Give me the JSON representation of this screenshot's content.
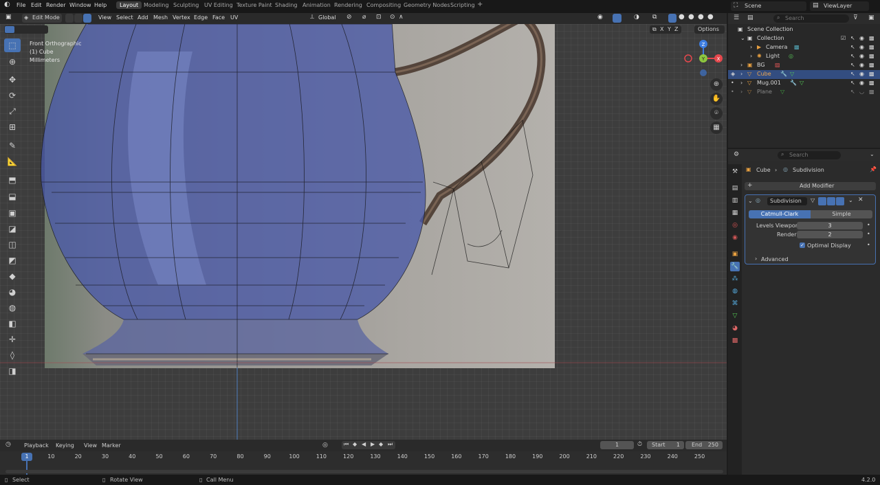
{
  "topbar": {
    "menus": [
      "File",
      "Edit",
      "Render",
      "Window",
      "Help"
    ],
    "workspaces": [
      "Layout",
      "Modeling",
      "Sculpting",
      "UV Editing",
      "Texture Paint",
      "Shading",
      "Animation",
      "Rendering",
      "Compositing",
      "Geometry Nodes",
      "Scripting"
    ],
    "active_workspace": "Layout",
    "scene": "Scene",
    "view_layer": "ViewLayer"
  },
  "viewport_header": {
    "mode": "Edit Mode",
    "menus": [
      "View",
      "Select",
      "Add",
      "Mesh",
      "Vertex",
      "Edge",
      "Face",
      "UV"
    ],
    "transform_orientation": "Global",
    "axes": [
      "X",
      "Y",
      "Z"
    ],
    "options": "Options"
  },
  "viewport": {
    "view_name": "Front Orthographic",
    "object_label": "(1) Cube",
    "units": "Millimeters",
    "gizmo_axes": [
      "Z",
      "Y",
      "X"
    ]
  },
  "outliner": {
    "search_placeholder": "Search",
    "root": "Scene Collection",
    "items": [
      {
        "label": "Collection",
        "selected": false
      },
      {
        "label": "Camera",
        "selected": false
      },
      {
        "label": "Light",
        "selected": false
      },
      {
        "label": "BG",
        "selected": false
      },
      {
        "label": "Cube",
        "selected": true
      },
      {
        "label": "Mug.001",
        "selected": false
      },
      {
        "label": "Plane",
        "selected": false
      }
    ]
  },
  "properties": {
    "search_placeholder": "Search",
    "breadcrumb_object": "Cube",
    "breadcrumb_modifier": "Subdivision",
    "add_modifier": "Add Modifier",
    "modifier_name": "Subdivision",
    "method_options": [
      "Catmull-Clark",
      "Simple"
    ],
    "selected_method": "Catmull-Clark",
    "levels_viewport_label": "Levels Viewport",
    "levels_viewport": "3",
    "render_label": "Render",
    "render": "2",
    "optimal_display_label": "Optimal Display",
    "optimal_display": true,
    "advanced_label": "Advanced"
  },
  "timeline": {
    "menus": [
      "Playback",
      "Keying",
      "View",
      "Marker"
    ],
    "current_frame": "1",
    "start_label": "Start",
    "start": "1",
    "end_label": "End",
    "end": "250",
    "ticks": [
      "10",
      "20",
      "30",
      "40",
      "50",
      "60",
      "70",
      "80",
      "90",
      "100",
      "110",
      "120",
      "130",
      "140",
      "150",
      "160",
      "170",
      "180",
      "190",
      "200",
      "210",
      "220",
      "230",
      "240",
      "250"
    ],
    "playhead_label": "1"
  },
  "statusbar": {
    "select": "Select",
    "rotate": "Rotate View",
    "call_menu": "Call Menu",
    "version": "4.2.0"
  },
  "colors": {
    "accent": "#4772b3",
    "selection_row": "#334d80",
    "axis_x": "#e5484d",
    "axis_y": "#8dc63f",
    "axis_z": "#3d7de0"
  }
}
